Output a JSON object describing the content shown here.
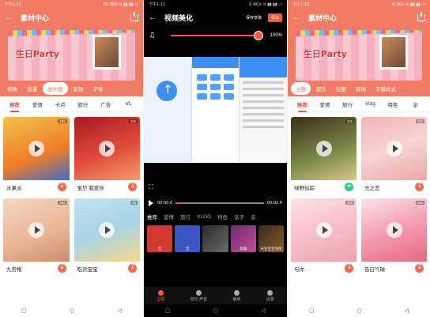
{
  "panel1": {
    "status": {
      "time": "下午1:11",
      "right": "78.7K/s ⊙ ▮▮ ▮▮ ▭"
    },
    "title": "素材中心",
    "banner_text": "生日Party",
    "categories": [
      "特殊",
      "浪漫",
      "画中画",
      "音效",
      "字体"
    ],
    "active_category": 2,
    "subtabs": [
      "推荐",
      "爱情",
      "卡点",
      "旅行",
      "广告",
      "VL"
    ],
    "active_subtab": 0,
    "cards": [
      {
        "name": "水果派",
        "duration": "10s",
        "bg": "linear-gradient(160deg,#f2c24a,#ef7c2a 60%,#3d6fc4)"
      },
      {
        "name": "宝贝 我爱你",
        "duration": "10s",
        "bg": "linear-gradient(160deg,#a81a22,#e14b3c 55%,#f29d6a)"
      },
      {
        "name": "九宫格",
        "duration": "15s",
        "bg": "linear-gradient(160deg,#f4d7c4,#e9b393 60%,#c98d6d)"
      },
      {
        "name": "吃货宝宝",
        "duration": "9s",
        "bg": "linear-gradient(160deg,#c4e2ef,#a6d4e6 50%,#f7d88b)"
      }
    ]
  },
  "panel2": {
    "status": {
      "time": "下午1:11",
      "right": "0.4K/s ⊙ ▮▮ ▮▮ ▭"
    },
    "title": "视频美化",
    "save_draft": "保存草稿",
    "export": "导出",
    "volume": "100%",
    "time_current": "00:00.0",
    "time_total": "00:02.4",
    "template_tabs": [
      "推荐",
      "爱情",
      "旅行",
      "VLOG",
      "特色",
      "亲子",
      "亲"
    ],
    "active_template_tab": 0,
    "templates": [
      {
        "label": "无",
        "bg": "#d23a2f"
      },
      {
        "label": "无",
        "bg": "#3d56c6"
      },
      {
        "label": "",
        "bg": "linear-gradient(135deg,#2a2a2a,#6a6a6a)"
      },
      {
        "label": "剪辑",
        "bg": "linear-gradient(135deg,#6b2c7a,#c24d91)"
      },
      {
        "label": "天生宝宝为你",
        "bg": "linear-gradient(135deg,#3a2a1a,#8a5a2a)"
      }
    ],
    "edit_tabs": [
      "主题",
      "音乐 声音",
      "编辑",
      "设置"
    ],
    "active_edit_tab": 0
  },
  "panel3": {
    "status": {
      "time": "下午1:12",
      "right": "0.1K/s ⊙ ▮▮ ▮▮ ▭"
    },
    "title": "素材中心",
    "banner_text": "生日Party",
    "categories": [
      "主题",
      "配乐",
      "贴图",
      "转场",
      "字幕样式"
    ],
    "active_category": 0,
    "subtabs": [
      "推荐",
      "爱情",
      "旅行",
      "Vlog",
      "特色",
      "亲"
    ],
    "active_subtab": 0,
    "cards": [
      {
        "name": "绿野仙踪",
        "duration": "10s",
        "bg": "linear-gradient(160deg,#3c2e1a,#7d8c4a 60%,#d9c98a)",
        "action": "plus"
      },
      {
        "name": "元之恋",
        "duration": "10s",
        "bg": "linear-gradient(160deg,#f2b5b5,#f7d4d2 50%,#e9a9a6)",
        "action": "download"
      },
      {
        "name": "与你",
        "duration": "15s",
        "bg": "linear-gradient(160deg,#fde2e2,#f7c1c9 50%,#e9a3ae)",
        "action": "download"
      },
      {
        "name": "告白气球",
        "duration": "15s",
        "bg": "linear-gradient(160deg,#fbe4ea,#f49db0 50%,#e46981)",
        "action": "download"
      }
    ]
  },
  "navbar": [
    "▢",
    "○",
    "◁"
  ],
  "colors": {
    "accent": "#f27b66",
    "export": "#ef5b3b",
    "green": "#2fca88"
  }
}
